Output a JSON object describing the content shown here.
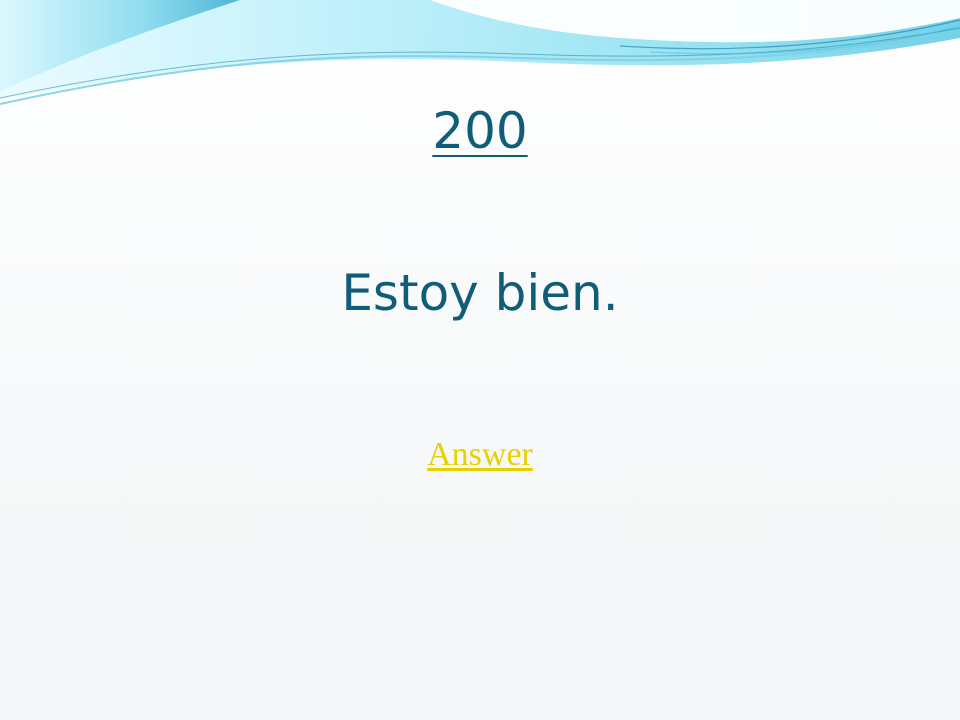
{
  "slide": {
    "title": "200",
    "prompt_text": "Estoy bien.",
    "answer_link": "Answer"
  },
  "colors": {
    "text_primary": "#0f5d79",
    "link_answer": "#e6d200",
    "wave_light": "#d9f4fb",
    "wave_mid": "#8fdcf0",
    "wave_dark": "#2aa6c9"
  }
}
